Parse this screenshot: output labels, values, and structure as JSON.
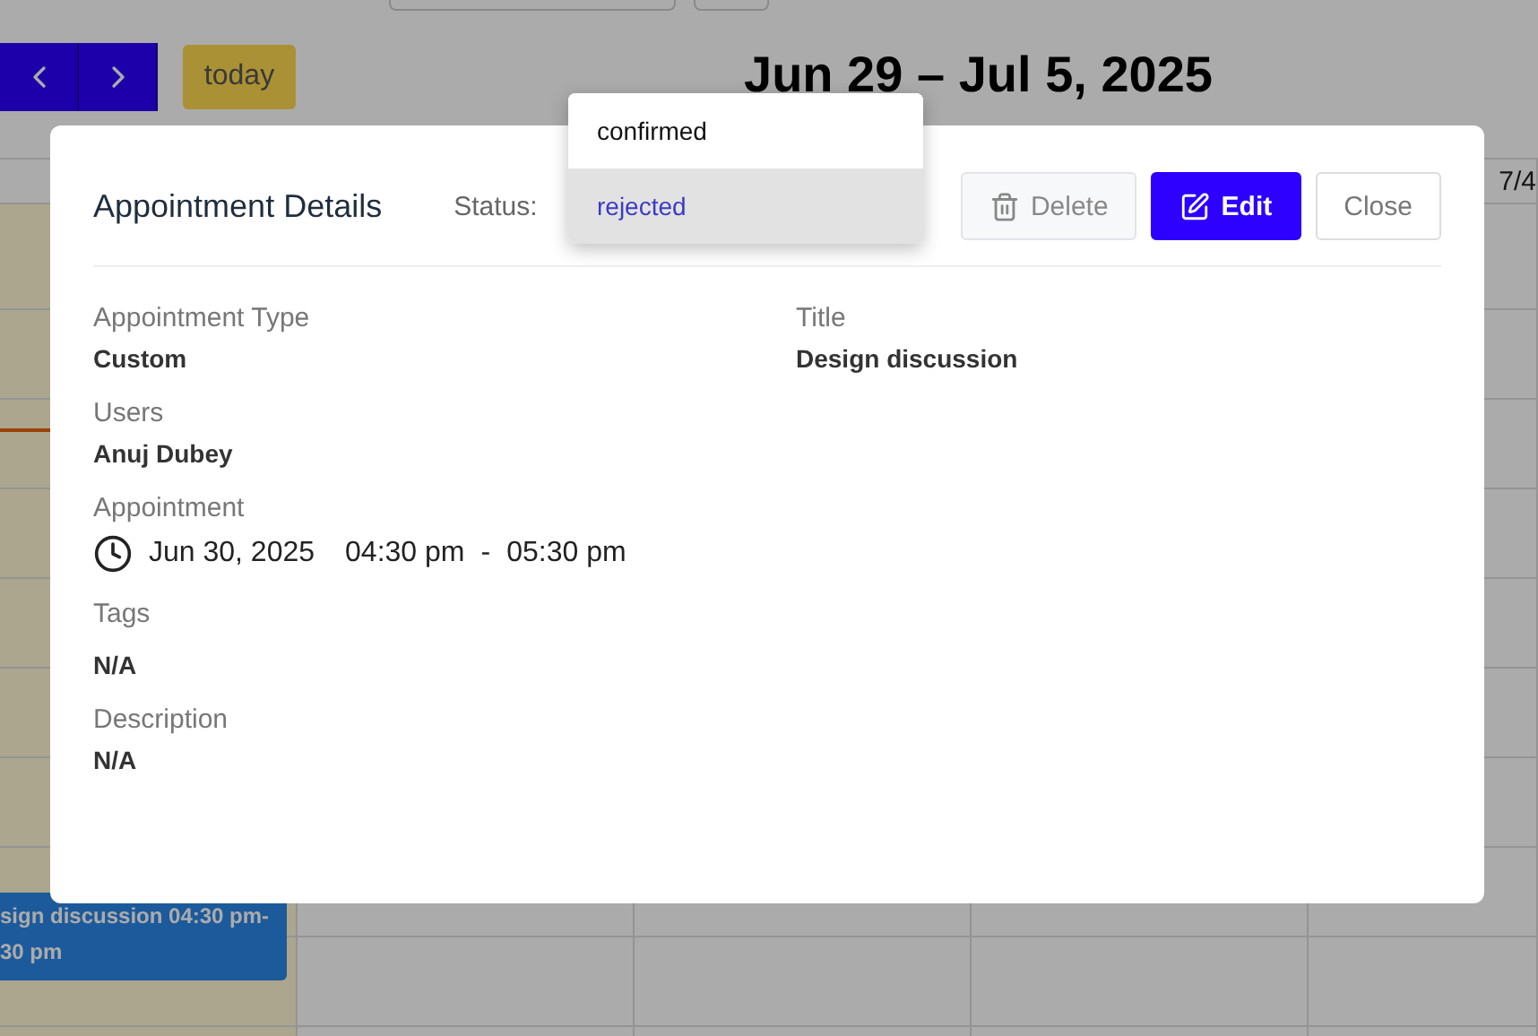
{
  "calendar": {
    "today_button": "today",
    "title": "Jun 29 – Jul 5, 2025",
    "visible_header": "7/4",
    "event": {
      "lines": [
        "sign discussion 04:30 pm-",
        "30 pm"
      ]
    }
  },
  "modal": {
    "title": "Appointment Details",
    "status_label": "Status:",
    "status_menu": [
      {
        "label": "confirmed",
        "selected": false
      },
      {
        "label": "rejected",
        "selected": true
      }
    ],
    "buttons": [
      {
        "label": "Delete",
        "kind": "secondary"
      },
      {
        "label": "Edit",
        "kind": "primary"
      },
      {
        "label": "Close",
        "kind": "plain"
      }
    ],
    "fields": [
      {
        "kind": "text",
        "label": "Appointment Type",
        "value": "Custom"
      },
      {
        "kind": "text",
        "label": "Title",
        "value": "Design discussion"
      },
      {
        "kind": "text",
        "label": "Users",
        "value": "Anuj Dubey"
      },
      {
        "kind": "datetime",
        "label": "Appointment",
        "date": "Jun 30, 2025",
        "start": "04:30 pm",
        "separator": "-",
        "end": "05:30 pm"
      },
      {
        "kind": "text",
        "label": "Tags",
        "value": "N/A"
      },
      {
        "kind": "text",
        "label": "Description",
        "value": "N/A"
      }
    ]
  }
}
